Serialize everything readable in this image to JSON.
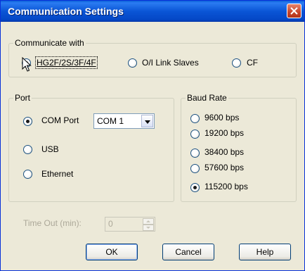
{
  "window": {
    "title": "Communication Settings",
    "close_icon": "close-icon"
  },
  "communicate_with": {
    "legend": "Communicate with",
    "options": [
      {
        "label": "HG2F/2S/3F/4F",
        "checked": true
      },
      {
        "label": "O/I Link Slaves",
        "checked": false
      },
      {
        "label": "CF",
        "checked": false
      }
    ]
  },
  "port": {
    "legend": "Port",
    "com_port_label": "COM Port",
    "com_port_value": "COM 1",
    "usb_label": "USB",
    "ethernet_label": "Ethernet",
    "selected": "COM Port"
  },
  "baud_rate": {
    "legend": "Baud Rate",
    "options": [
      "9600 bps",
      "19200 bps",
      "38400 bps",
      "57600 bps",
      "115200 bps"
    ],
    "selected": "115200 bps"
  },
  "timeout": {
    "label": "Time Out (min):",
    "value": "0"
  },
  "buttons": {
    "ok": "OK",
    "cancel": "Cancel",
    "help": "Help"
  }
}
